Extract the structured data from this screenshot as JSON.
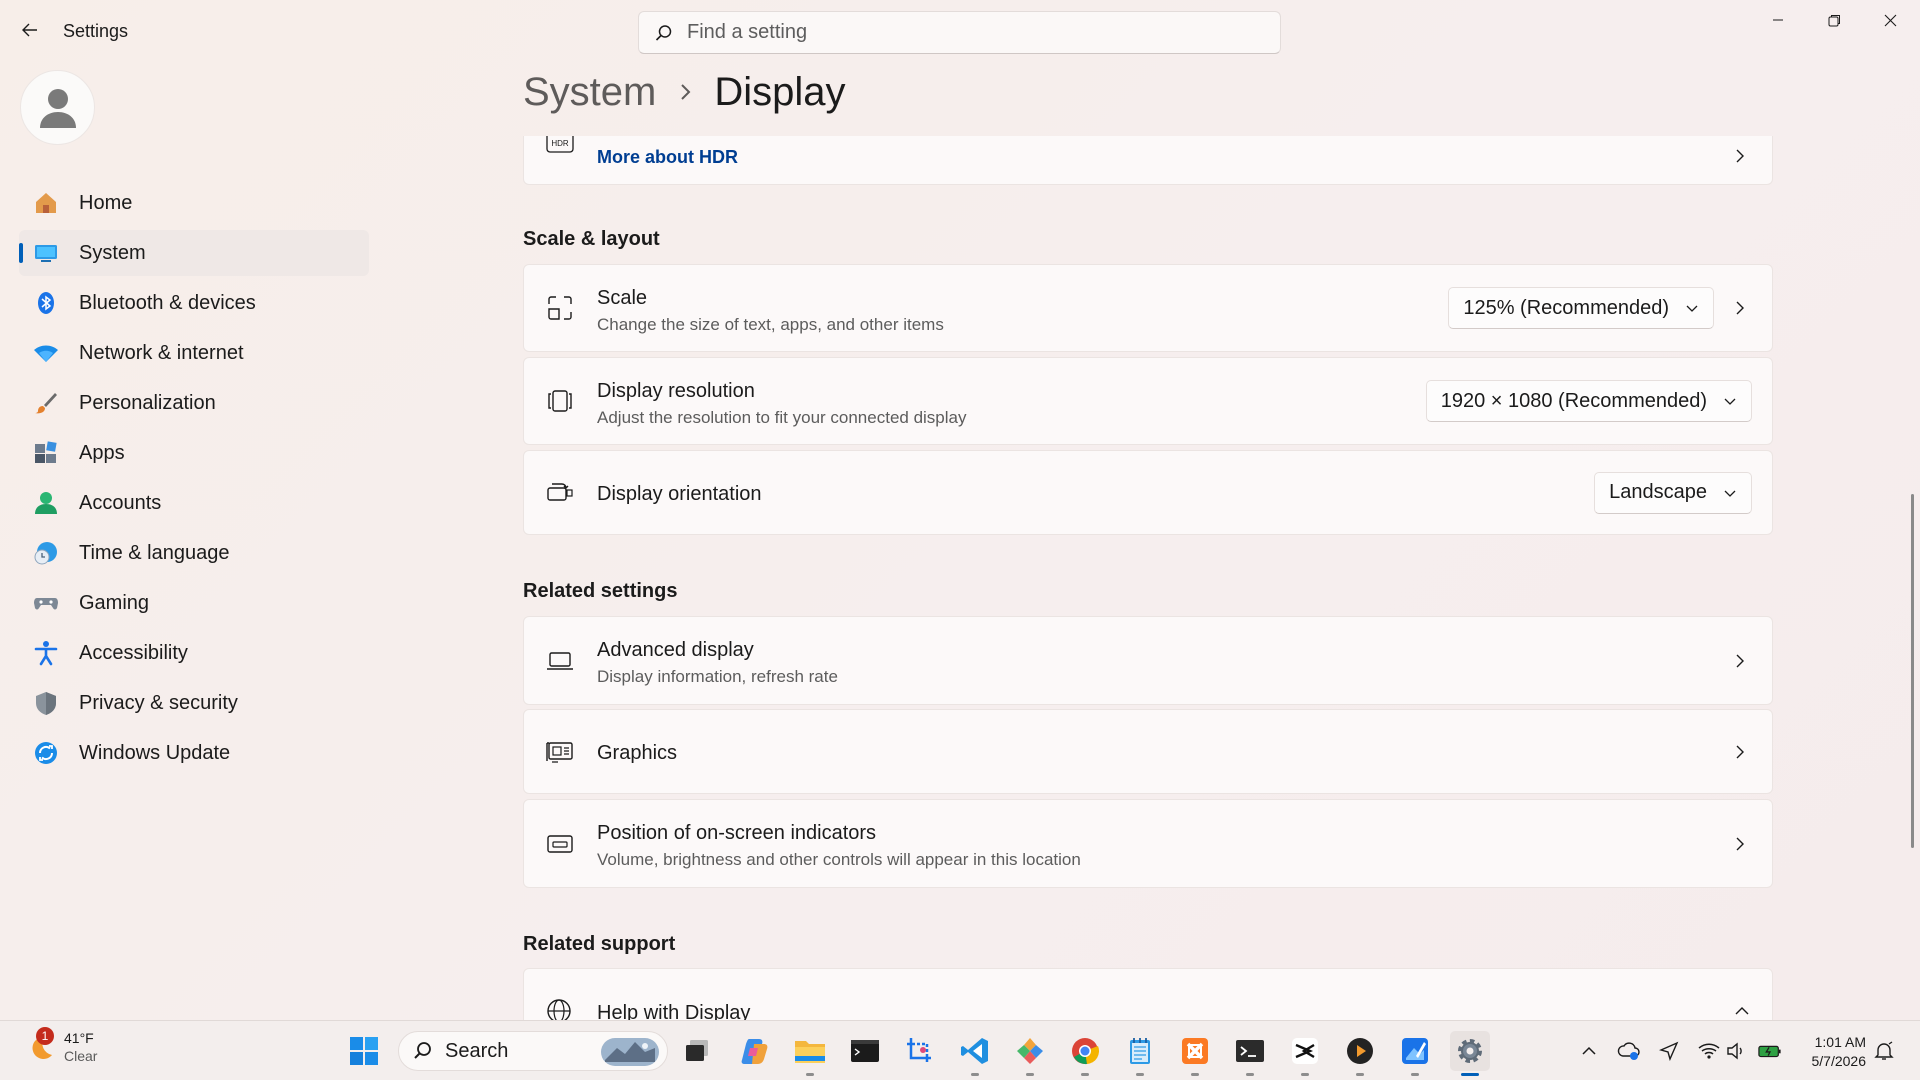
{
  "window": {
    "title": "Settings",
    "search_placeholder": "Find a setting"
  },
  "sidebar": {
    "items": [
      {
        "label": "Home",
        "icon": "home-icon"
      },
      {
        "label": "System",
        "icon": "system-icon",
        "active": true
      },
      {
        "label": "Bluetooth & devices",
        "icon": "bluetooth-icon"
      },
      {
        "label": "Network & internet",
        "icon": "wifi-icon"
      },
      {
        "label": "Personalization",
        "icon": "brush-icon"
      },
      {
        "label": "Apps",
        "icon": "apps-icon"
      },
      {
        "label": "Accounts",
        "icon": "accounts-icon"
      },
      {
        "label": "Time & language",
        "icon": "clock-globe-icon"
      },
      {
        "label": "Gaming",
        "icon": "gamepad-icon"
      },
      {
        "label": "Accessibility",
        "icon": "accessibility-icon"
      },
      {
        "label": "Privacy & security",
        "icon": "shield-icon"
      },
      {
        "label": "Windows Update",
        "icon": "update-icon"
      }
    ]
  },
  "breadcrumb": {
    "parent": "System",
    "current": "Display"
  },
  "hdr": {
    "link": "More about HDR"
  },
  "scale_layout": {
    "title": "Scale & layout",
    "scale": {
      "title": "Scale",
      "desc": "Change the size of text, apps, and other items",
      "value": "125% (Recommended)"
    },
    "resolution": {
      "title": "Display resolution",
      "desc": "Adjust the resolution to fit your connected display",
      "value": "1920 × 1080 (Recommended)"
    },
    "orientation": {
      "title": "Display orientation",
      "value": "Landscape"
    }
  },
  "related_settings": {
    "title": "Related settings",
    "items": [
      {
        "title": "Advanced display",
        "desc": "Display information, refresh rate"
      },
      {
        "title": "Graphics",
        "desc": ""
      },
      {
        "title": "Position of on-screen indicators",
        "desc": "Volume, brightness and other controls will appear in this location"
      }
    ]
  },
  "related_support": {
    "title": "Related support",
    "help": "Help with Display"
  },
  "taskbar": {
    "weather_temp": "41°F",
    "weather_cond": "Clear",
    "weather_badge": "1",
    "search_label": "Search",
    "time": "1:01 AM",
    "date": "5/7/2026"
  },
  "colors": {
    "accent": "#005fb8",
    "link": "#003e92"
  }
}
